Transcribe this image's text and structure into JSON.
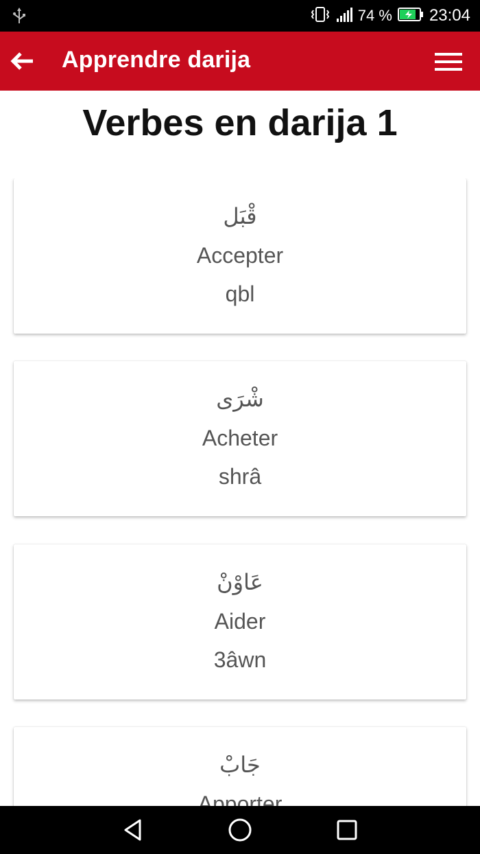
{
  "status_bar": {
    "battery_percent": "74 %",
    "time": "23:04",
    "icons": [
      "usb-icon",
      "vibrate-icon",
      "signal-icon",
      "battery-charging-icon"
    ]
  },
  "app_bar": {
    "title": "Apprendre darija",
    "back_icon": "arrow-left-icon",
    "menu_icon": "hamburger-menu-icon"
  },
  "page": {
    "title": "Verbes en darija 1"
  },
  "cards": [
    {
      "arabic": "قْبَل",
      "french": "Accepter",
      "latin": "qbl"
    },
    {
      "arabic": "شْرَى",
      "french": "Acheter",
      "latin": "shrâ"
    },
    {
      "arabic": "عَاوْنْ",
      "french": "Aider",
      "latin": "3âwn"
    },
    {
      "arabic": "جَابْ",
      "french": "Apporter",
      "latin": ""
    }
  ],
  "nav_bar": {
    "icons": [
      "back-triangle-icon",
      "home-circle-icon",
      "recents-square-icon"
    ]
  },
  "colors": {
    "app_bar": "#c70c1e",
    "status_bar": "#000000",
    "card_text": "#555555"
  }
}
